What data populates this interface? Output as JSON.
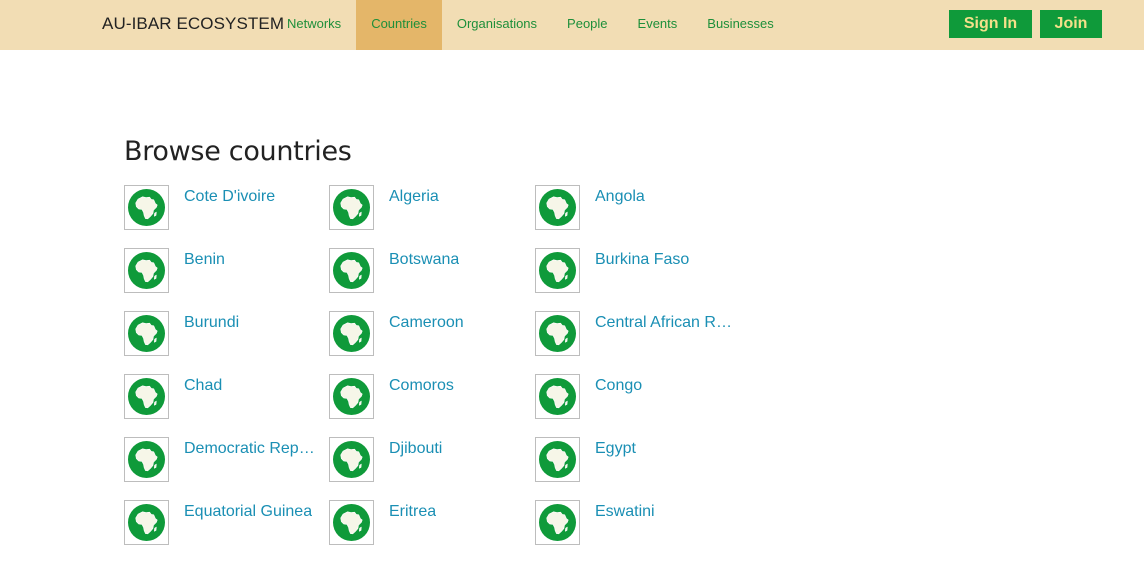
{
  "brand": "AU-IBAR ECOSYSTEM",
  "nav": [
    {
      "label": "Networks",
      "active": false
    },
    {
      "label": "Countries",
      "active": true
    },
    {
      "label": "Organisations",
      "active": false
    },
    {
      "label": "People",
      "active": false
    },
    {
      "label": "Events",
      "active": false
    },
    {
      "label": "Businesses",
      "active": false
    }
  ],
  "auth": {
    "signin_label": "Sign In",
    "join_label": "Join"
  },
  "page": {
    "title": "Browse countries"
  },
  "countries": [
    "Cote D'ivoire",
    "Algeria",
    "Angola",
    "Benin",
    "Botswana",
    "Burkina Faso",
    "Burundi",
    "Cameroon",
    "Central African Republic",
    "Chad",
    "Comoros",
    "Congo",
    "Democratic Republic of the Congo",
    "Djibouti",
    "Egypt",
    "Equatorial Guinea",
    "Eritrea",
    "Eswatini"
  ],
  "flag_icon": "africa-map-icon",
  "colors": {
    "navbar_bg": "#f2ddb4",
    "nav_active_bg": "#e4b669",
    "nav_link": "#1e8f3a",
    "button_bg": "#0f9a3a",
    "button_text": "#f4e08a",
    "country_link": "#1a8fb4",
    "flag_green": "#0f9a3a"
  }
}
